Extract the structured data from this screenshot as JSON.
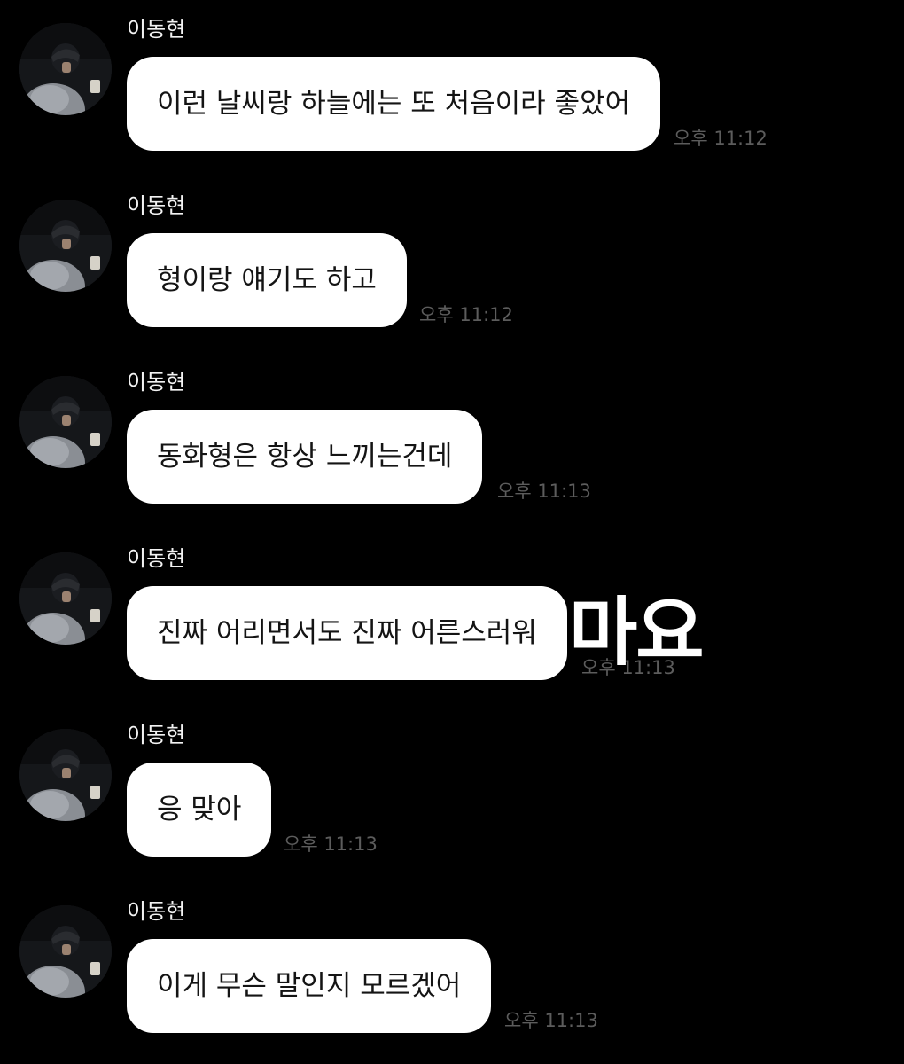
{
  "colors": {
    "background": "#000000",
    "bubble": "#ffffff",
    "bubble_text": "#141414",
    "sender_text": "#f2f2f2",
    "time_text": "#5c5c5c"
  },
  "icons": {
    "avatar": "profile-photo"
  },
  "messages": [
    {
      "sender": "이동현",
      "text": "이런 날씨랑 하늘에는 또 처음이라 좋았어",
      "time": "오후 11:12"
    },
    {
      "sender": "이동현",
      "text": "형이랑 얘기도 하고",
      "time": "오후 11:12"
    },
    {
      "sender": "이동현",
      "text": "동화형은 항상 느끼는건데",
      "time": "오후 11:13"
    },
    {
      "sender": "이동현",
      "text": "진짜 어리면서도 진짜 어른스러워",
      "time": "오후 11:13"
    },
    {
      "sender": "이동현",
      "text": "응 맞아",
      "time": "오후 11:13"
    },
    {
      "sender": "이동현",
      "text": "이게 무슨 말인지 모르겠어",
      "time": "오후 11:13"
    }
  ],
  "overlay_text": "마요"
}
